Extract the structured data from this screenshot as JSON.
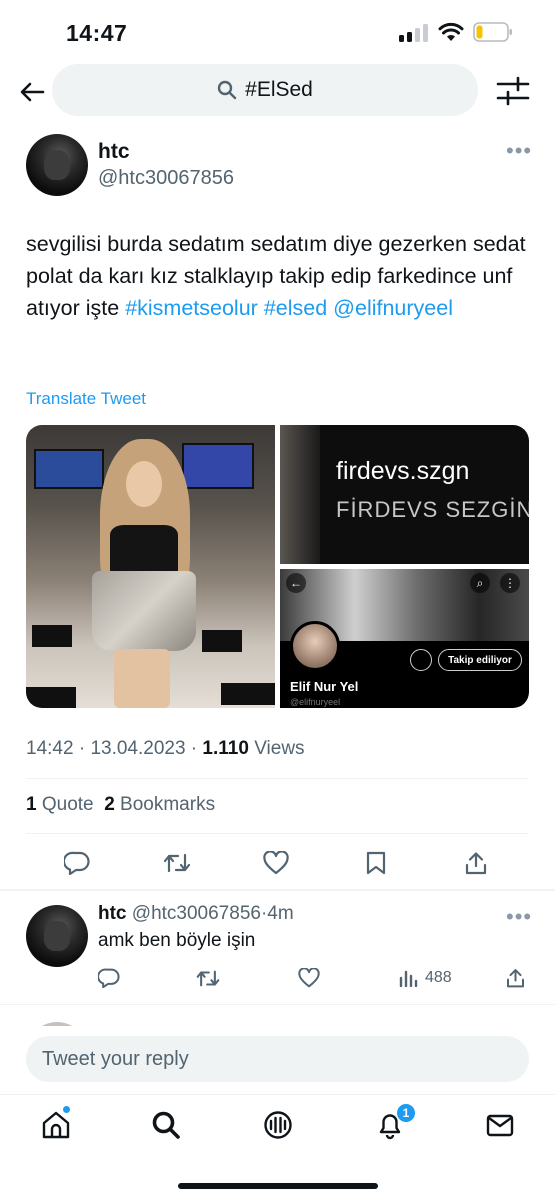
{
  "status_bar": {
    "time": "14:47"
  },
  "header": {
    "search_query": "#ElSed"
  },
  "tweet": {
    "author_name": "htc",
    "author_handle": "@htc30067856",
    "text_plain": "sevgilisi burda sedatım sedatım diye gezerken sedat polat da karı kız stalklayıp takip edip farkedince unf atıyor işte ",
    "hashtag1": "#kismetseolur",
    "hashtag2": "#elsed",
    "mention": "@elifnuryeel",
    "translate_label": "Translate Tweet",
    "media": {
      "top_right": {
        "username": "firdevs.szgn",
        "fullname": "FİRDEVS SEZGİN"
      },
      "bottom_right": {
        "profile_name": "Elif Nur Yel",
        "profile_handle": "@elifnuryeel",
        "follow_label": "Takip ediliyor"
      }
    },
    "time": "14:42",
    "date": "13.04.2023",
    "views_count": "1.110",
    "views_label": "Views",
    "quote_count": "1",
    "quote_label": "Quote",
    "bookmark_count": "2",
    "bookmark_label": "Bookmarks"
  },
  "reply": {
    "author_name": "htc",
    "author_handle": "@htc30067856",
    "age": "4m",
    "text": "amk ben böyle işin",
    "views": "488"
  },
  "reply_box": {
    "placeholder": "Tweet your reply"
  },
  "bottom_nav": {
    "notification_count": "1"
  },
  "colors": {
    "accent": "#1d9bf0",
    "text": "#0f1419",
    "secondary": "#536471",
    "pill_bg": "#eff3f4"
  },
  "icons": [
    "back-arrow-icon",
    "search-icon",
    "filter-icon",
    "more-icon",
    "reply-icon",
    "retweet-icon",
    "like-icon",
    "bookmark-icon",
    "share-icon",
    "views-icon",
    "home-icon",
    "explore-icon",
    "spaces-icon",
    "notifications-icon",
    "messages-icon"
  ]
}
